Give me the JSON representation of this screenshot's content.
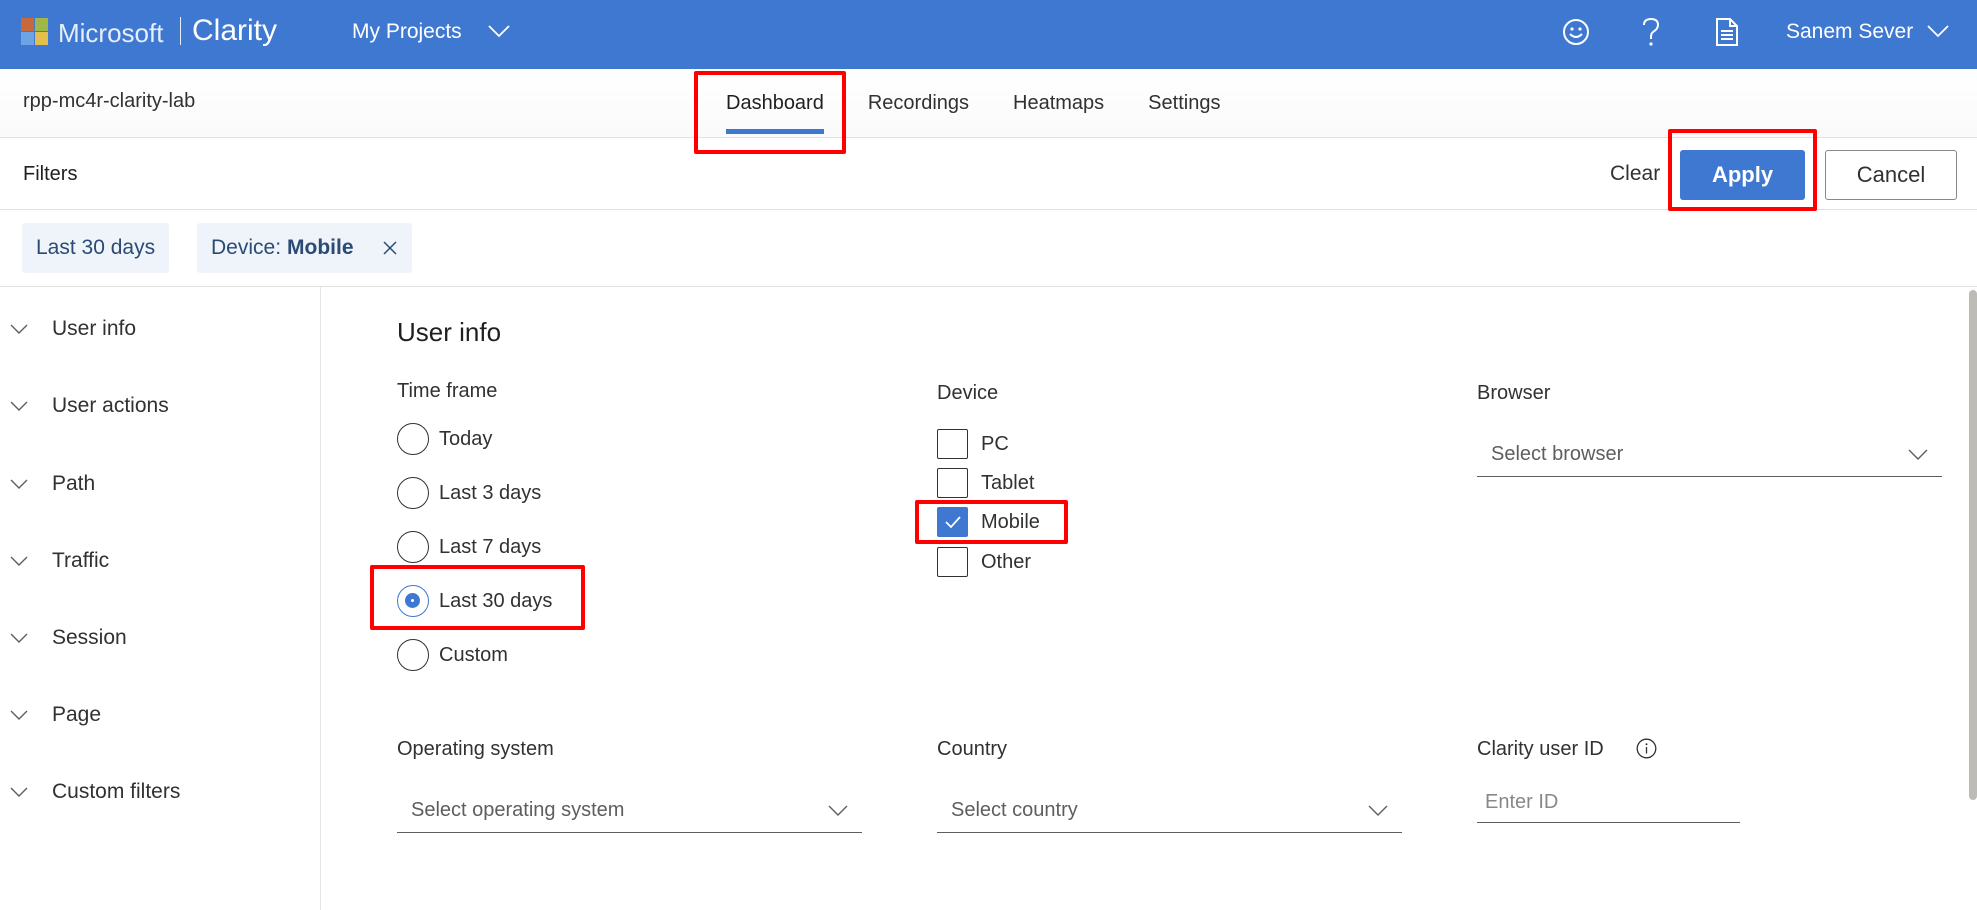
{
  "topbar": {
    "brand_company": "Microsoft",
    "brand_product": "Clarity",
    "projects_menu": "My Projects",
    "icons": [
      "smiley-feedback-icon",
      "help-icon",
      "document-icon"
    ],
    "user_name": "Sanem Sever"
  },
  "colors": {
    "brand_blue": "#3f78d0",
    "chip_bg": "#eef4fa",
    "annotation_red": "#ff0000"
  },
  "project": {
    "name": "rpp-mc4r-clarity-lab"
  },
  "nav": {
    "tabs": [
      {
        "label": "Dashboard",
        "active": true
      },
      {
        "label": "Recordings",
        "active": false
      },
      {
        "label": "Heatmaps",
        "active": false
      },
      {
        "label": "Settings",
        "active": false
      }
    ]
  },
  "filters": {
    "title": "Filters",
    "clear_label": "Clear",
    "apply_label": "Apply",
    "cancel_label": "Cancel",
    "chips": [
      {
        "label": "Last 30 days"
      },
      {
        "prefix": "Device:",
        "value": "Mobile",
        "removable": true
      }
    ]
  },
  "sidebar": {
    "items": [
      {
        "label": "User info"
      },
      {
        "label": "User actions"
      },
      {
        "label": "Path"
      },
      {
        "label": "Traffic"
      },
      {
        "label": "Session"
      },
      {
        "label": "Page"
      },
      {
        "label": "Custom filters"
      }
    ]
  },
  "user_info": {
    "title": "User info",
    "time_frame": {
      "label": "Time frame",
      "options": [
        {
          "label": "Today",
          "selected": false
        },
        {
          "label": "Last 3 days",
          "selected": false
        },
        {
          "label": "Last 7 days",
          "selected": false
        },
        {
          "label": "Last 30 days",
          "selected": true
        },
        {
          "label": "Custom",
          "selected": false
        }
      ]
    },
    "device": {
      "label": "Device",
      "options": [
        {
          "label": "PC",
          "checked": false
        },
        {
          "label": "Tablet",
          "checked": false
        },
        {
          "label": "Mobile",
          "checked": true
        },
        {
          "label": "Other",
          "checked": false
        }
      ]
    },
    "browser": {
      "label": "Browser",
      "placeholder": "Select browser"
    },
    "operating_system": {
      "label": "Operating system",
      "placeholder": "Select operating system"
    },
    "country": {
      "label": "Country",
      "placeholder": "Select country"
    },
    "clarity_user_id": {
      "label": "Clarity user ID",
      "placeholder": "Enter ID",
      "value": ""
    }
  }
}
